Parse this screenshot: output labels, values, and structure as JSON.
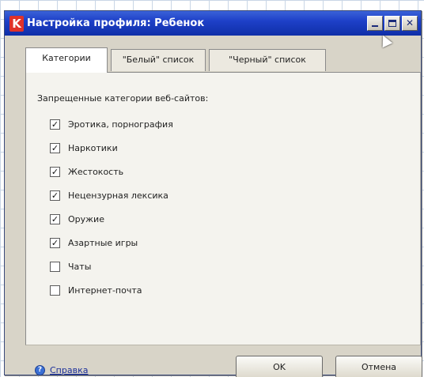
{
  "window": {
    "title": "Настройка профиля: Ребенок",
    "app_icon_letter": "K",
    "icons": {
      "app": "kaspersky-k-icon",
      "minimize": "minimize-icon",
      "maximize": "maximize-icon",
      "close": "close-icon",
      "help": "help-question-icon"
    }
  },
  "tabs": [
    {
      "label": "Категории",
      "active": true
    },
    {
      "label": "\"Белый\" список",
      "active": false
    },
    {
      "label": "\"Черный\" список",
      "active": false
    }
  ],
  "panel": {
    "group_label": "Запрещенные категории веб-сайтов:",
    "categories": [
      {
        "label": "Эротика, порнография",
        "checked": true
      },
      {
        "label": "Наркотики",
        "checked": true
      },
      {
        "label": "Жестокость",
        "checked": true
      },
      {
        "label": "Нецензурная лексика",
        "checked": true
      },
      {
        "label": "Оружие",
        "checked": true
      },
      {
        "label": "Азартные игры",
        "checked": true
      },
      {
        "label": "Чаты",
        "checked": false
      },
      {
        "label": "Интернет-почта",
        "checked": false
      }
    ]
  },
  "footer": {
    "help_label": "Справка",
    "ok_label": "OK",
    "cancel_label": "Отмена"
  },
  "colors": {
    "titlebar": "#1e40c8",
    "window_bg": "#d8d4c8",
    "panel_bg": "#f4f3ee",
    "link": "#1a2e9a",
    "app_icon": "#e0322a"
  }
}
